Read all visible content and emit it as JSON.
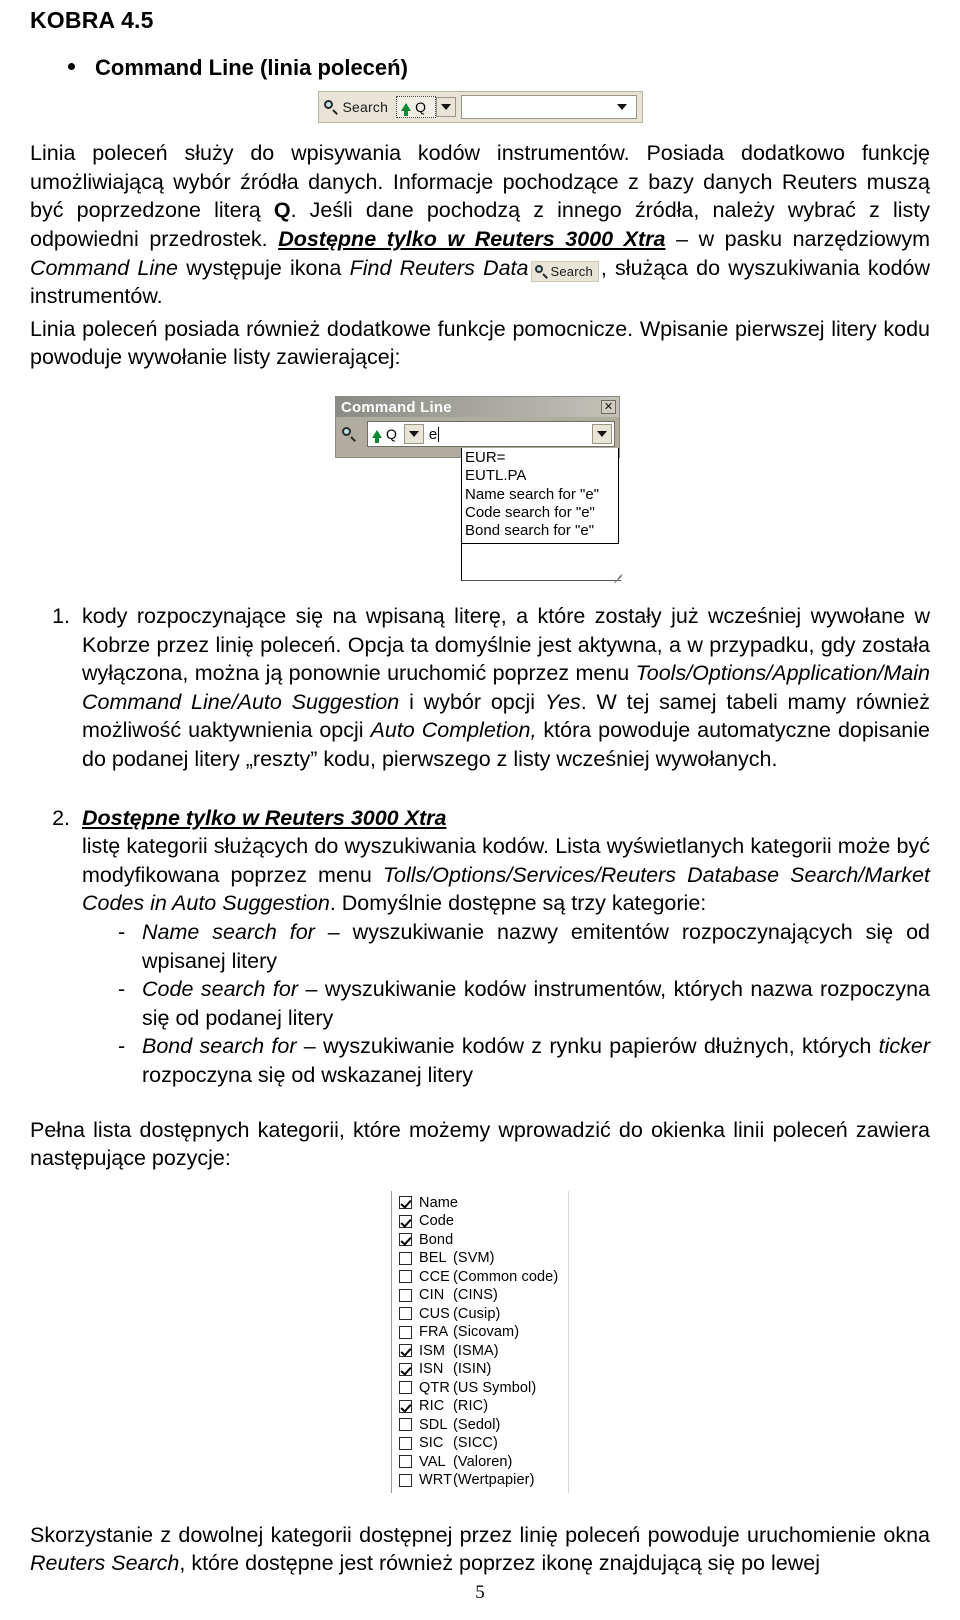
{
  "document": {
    "header": "KOBRA 4.5",
    "page_number": "5"
  },
  "heading": {
    "bullet_label": "Command Line (linia poleceń)"
  },
  "toolbar_figure": {
    "search_label": "Search",
    "prefix_letter": "Q",
    "dropdown_icon": "chevron-down-icon",
    "magnifier_icon": "search-icon",
    "input_value": ""
  },
  "paragraphs": {
    "p1_part1": "Linia poleceń służy do wpisywania kodów instrumentów. Posiada dodatkowo funkcję umożliwiającą wybór źródła danych. Informacje pochodzące z bazy danych Reuters muszą być poprzedzone literą ",
    "p1_bold_q": "Q",
    "p1_part2": ". Jeśli dane pochodzą z innego źródła, należy wybrać z listy odpowiedni przedrostek. ",
    "p1_emph": "Dostępne tylko w Reuters 3000 Xtra",
    "p1_part3": " – w pasku narzędziowym ",
    "p1_italic1": "Command Line",
    "p1_part4": " występuje ikona ",
    "p1_italic2": "Find Reuters Data",
    "p1_inline_icon_label": "Search",
    "p1_part5": ", służąca do wyszukiwania kodów instrumentów.",
    "p2": "Linia poleceń posiada również dodatkowe funkcje pomocnicze. Wpisanie pierwszej litery kodu powoduje wywołanie listy zawierającej:"
  },
  "dialog_figure": {
    "title": "Command Line",
    "close_icon": "close-icon",
    "magnifier_icon": "search-icon",
    "prefix_letter": "Q",
    "input_value": "e",
    "suggestions": [
      "EUR=",
      "EUTL.PA",
      "Name search for \"e\"",
      "Code search for \"e\"",
      "Bond search for \"e\""
    ]
  },
  "numbered_list": [
    {
      "marker": "1.",
      "seg1": "kody rozpoczynające się na wpisaną literę, a które zostały już wcześniej wywołane w Kobrze przez linię poleceń. Opcja ta domyślnie jest aktywna, a w przypadku, gdy została wyłączona, można ją ponownie uruchomić poprzez menu ",
      "italic1": "Tools/Options/Application/Main Command Line/Auto Suggestion",
      "seg2": " i wybór opcji ",
      "italic2": "Yes",
      "seg3": ". W tej samej tabeli mamy również możliwość uaktywnienia opcji ",
      "italic3": "Auto Completion,",
      "seg4": " która powoduje automatyczne dopisanie do podanej litery „reszty” kodu, pierwszego z listy wcześniej wywołanych."
    },
    {
      "marker": "2.",
      "emph": "Dostępne tylko w Reuters 3000 Xtra",
      "seg1": "listę kategorii służących do wyszukiwania kodów. Lista wyświetlanych kategorii może być modyfikowana poprzez menu ",
      "italic1": "Tolls/Options/Services/Reuters Database Search/Market Codes in Auto Suggestion",
      "seg2": ". Domyślnie dostępne są trzy kategorie:",
      "sub_items": [
        {
          "italic": "Name search for",
          "text": " – wyszukiwanie nazwy emitentów rozpoczynających się od wpisanej litery"
        },
        {
          "italic": "Code search for",
          "text": " – wyszukiwanie kodów instrumentów, których nazwa rozpoczyna się od podanej litery"
        },
        {
          "italic": "Bond search for",
          "text": " – wyszukiwanie kodów z rynku papierów dłużnych, których ",
          "italic2": "ticker",
          "text2": " rozpoczyna się od wskazanej litery"
        }
      ]
    }
  ],
  "paragraph_after_list": "Pełna lista dostępnych kategorii, które możemy wprowadzić do okienka linii poleceń zawiera następujące pozycje:",
  "checkbox_figure": {
    "items": [
      {
        "checked": true,
        "code": "Name",
        "desc": ""
      },
      {
        "checked": true,
        "code": "Code",
        "desc": ""
      },
      {
        "checked": true,
        "code": "Bond",
        "desc": ""
      },
      {
        "checked": false,
        "code": "BEL",
        "desc": "(SVM)"
      },
      {
        "checked": false,
        "code": "CCE",
        "desc": "(Common code)"
      },
      {
        "checked": false,
        "code": "CIN",
        "desc": "(CINS)"
      },
      {
        "checked": false,
        "code": "CUS",
        "desc": "(Cusip)"
      },
      {
        "checked": false,
        "code": "FRA",
        "desc": "(Sicovam)"
      },
      {
        "checked": true,
        "code": "ISM",
        "desc": "(ISMA)"
      },
      {
        "checked": true,
        "code": "ISN",
        "desc": "(ISIN)"
      },
      {
        "checked": false,
        "code": "QTR",
        "desc": "(US Symbol)"
      },
      {
        "checked": true,
        "code": "RIC",
        "desc": "(RIC)"
      },
      {
        "checked": false,
        "code": "SDL",
        "desc": "(Sedol)"
      },
      {
        "checked": false,
        "code": "SIC",
        "desc": "(SICC)"
      },
      {
        "checked": false,
        "code": "VAL",
        "desc": "(Valoren)"
      },
      {
        "checked": false,
        "code": "WRT",
        "desc": "(Wertpapier)"
      }
    ]
  },
  "final_paragraph": {
    "seg1": "Skorzystanie z dowolnej kategorii dostępnej przez linię poleceń powoduje uruchomienie okna ",
    "italic1": "Reuters Search",
    "seg2": ", które dostępne jest również poprzez ikonę znajdującą się po lewej"
  }
}
